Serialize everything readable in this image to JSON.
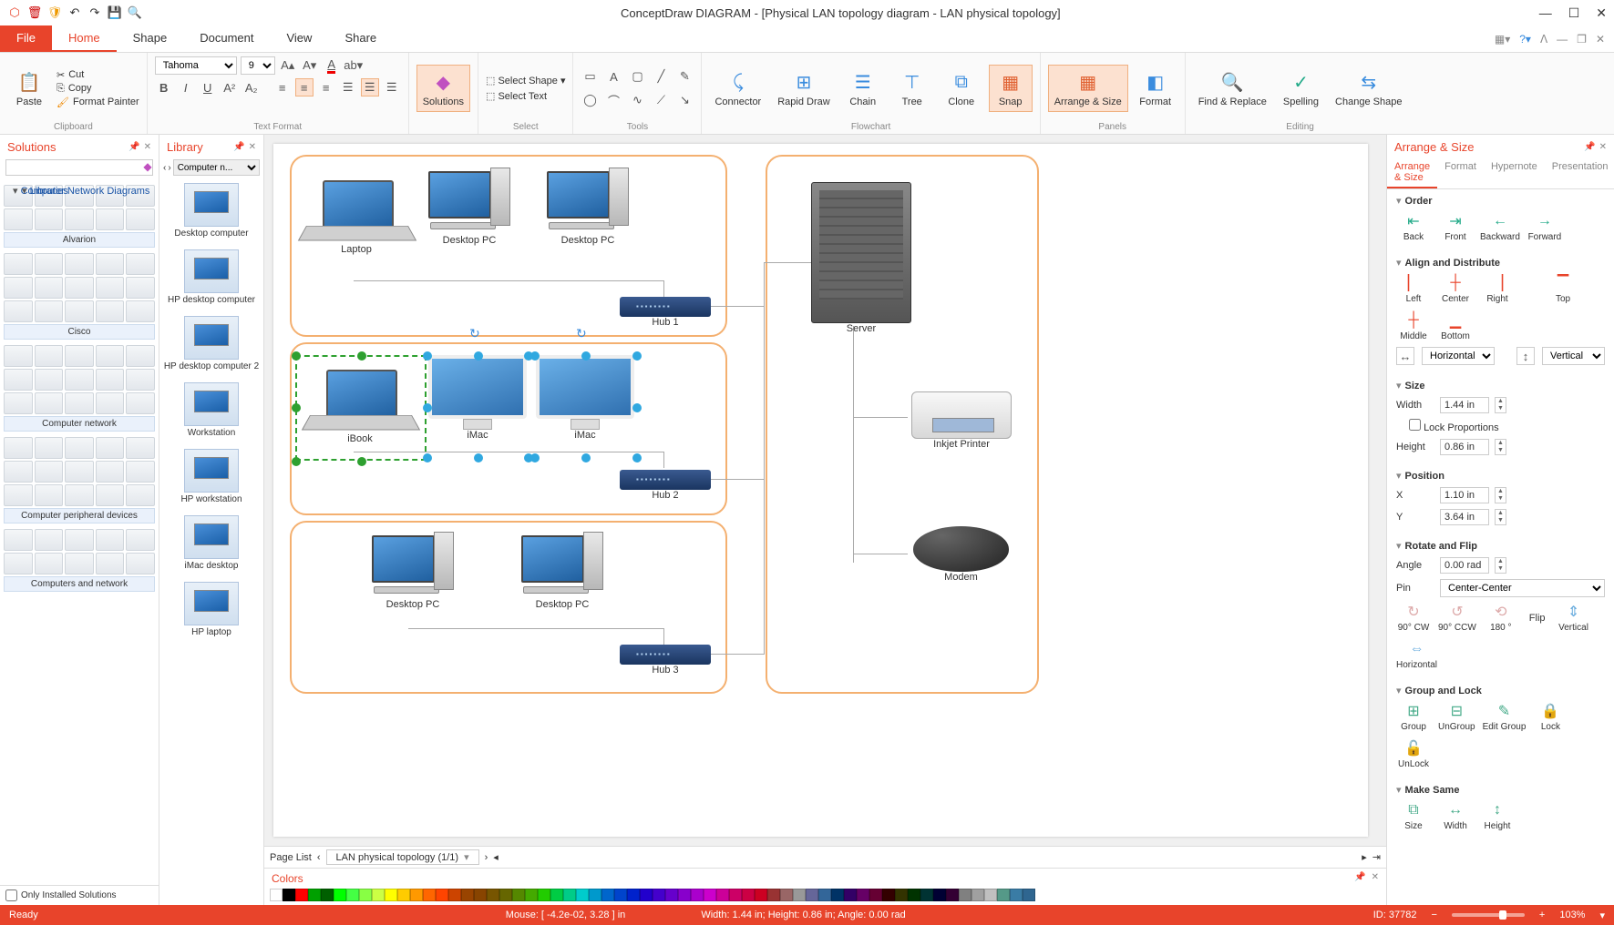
{
  "app": {
    "title": "ConceptDraw DIAGRAM - [Physical LAN topology diagram - LAN physical topology]"
  },
  "window_controls": {
    "min": "—",
    "max": "☐",
    "close": "✕"
  },
  "qat": {
    "logo": "⬡",
    "trash": "🗑",
    "shield": "🛡",
    "undo": "↶",
    "redo": "↷",
    "save": "💾",
    "preview": "🔍"
  },
  "tabs": {
    "file": "File",
    "home": "Home",
    "shape": "Shape",
    "document": "Document",
    "view": "View",
    "share": "Share"
  },
  "ribbon": {
    "clipboard": {
      "paste": "Paste",
      "cut": "Cut",
      "copy": "Copy",
      "format_painter": "Format Painter",
      "label": "Clipboard"
    },
    "textfmt": {
      "font": "Tahoma",
      "size": "9",
      "label": "Text Format"
    },
    "solutions": {
      "label": "Solutions"
    },
    "select": {
      "select_shape": "Select Shape",
      "select_text": "Select Text",
      "label": "Select"
    },
    "tools": {
      "label": "Tools"
    },
    "flowchart": {
      "connector": "Connector",
      "rapid": "Rapid Draw",
      "chain": "Chain",
      "tree": "Tree",
      "clone": "Clone",
      "snap": "Snap",
      "label": "Flowchart"
    },
    "panels": {
      "arrange": "Arrange & Size",
      "format": "Format",
      "label": "Panels"
    },
    "editing": {
      "find": "Find & Replace",
      "spelling": "Spelling",
      "change": "Change Shape",
      "label": "Editing"
    }
  },
  "solutions_panel": {
    "title": "Solutions",
    "tree_root": "Computer Network Diagrams",
    "tree_child": "Libraries",
    "groups": [
      "Alvarion",
      "Cisco",
      "Computer network",
      "Computer peripheral devices",
      "Computers and network"
    ],
    "only_installed": "Only Installed Solutions"
  },
  "library_panel": {
    "title": "Library",
    "dropdown": "Computer n...",
    "items": [
      "Desktop computer",
      "HP desktop computer",
      "HP desktop computer 2",
      "Workstation",
      "HP workstation",
      "iMac desktop",
      "HP laptop"
    ]
  },
  "canvas": {
    "nodes": {
      "laptop1": "Laptop",
      "desktop1": "Desktop PC",
      "desktop2": "Desktop PC",
      "hub1": "Hub 1",
      "ibook": "iBook",
      "imac1": "iMac",
      "imac2": "iMac",
      "hub2": "Hub 2",
      "desktop3": "Desktop PC",
      "desktop4": "Desktop PC",
      "hub3": "Hub 3",
      "server": "Server",
      "printer": "Inkjet Printer",
      "modem": "Modem"
    }
  },
  "pagelist": {
    "label": "Page List",
    "page": "LAN physical topology (1/1)"
  },
  "colors_panel": {
    "title": "Colors"
  },
  "arrange_panel": {
    "title": "Arrange & Size",
    "subtabs": {
      "arrange": "Arrange & Size",
      "format": "Format",
      "hypernote": "Hypernote",
      "presentation": "Presentation"
    },
    "order": {
      "title": "Order",
      "back": "Back",
      "front": "Front",
      "backward": "Backward",
      "forward": "Forward"
    },
    "align": {
      "title": "Align and Distribute",
      "left": "Left",
      "center": "Center",
      "right": "Right",
      "top": "Top",
      "middle": "Middle",
      "bottom": "Bottom",
      "horizontal": "Horizontal",
      "vertical": "Vertical"
    },
    "size": {
      "title": "Size",
      "width_l": "Width",
      "width_v": "1.44 in",
      "height_l": "Height",
      "height_v": "0.86 in",
      "lock": "Lock Proportions"
    },
    "position": {
      "title": "Position",
      "x_l": "X",
      "x_v": "1.10 in",
      "y_l": "Y",
      "y_v": "3.64 in"
    },
    "rotate": {
      "title": "Rotate and Flip",
      "angle_l": "Angle",
      "angle_v": "0.00 rad",
      "pin_l": "Pin",
      "pin_v": "Center-Center",
      "cw": "90° CW",
      "ccw": "90° CCW",
      "r180": "180 °",
      "flip_l": "Flip",
      "fv": "Vertical",
      "fh": "Horizontal"
    },
    "group": {
      "title": "Group and Lock",
      "group": "Group",
      "ungroup": "UnGroup",
      "edit": "Edit Group",
      "lock": "Lock",
      "unlock": "UnLock"
    },
    "same": {
      "title": "Make Same",
      "size": "Size",
      "width": "Width",
      "height": "Height"
    }
  },
  "status": {
    "ready": "Ready",
    "mouse": "Mouse: [ -4.2e-02, 3.28 ] in",
    "dims": "Width: 1.44 in;  Height: 0.86 in;  Angle: 0.00 rad",
    "id": "ID: 37782",
    "zoom": "103%"
  },
  "swatches": [
    "#ffffff",
    "#000000",
    "#ff0000",
    "#00a000",
    "#006000",
    "#00ff00",
    "#44ff44",
    "#88ff44",
    "#ccff44",
    "#ffff00",
    "#ffcc00",
    "#ff9900",
    "#ff6600",
    "#ff4400",
    "#cc4400",
    "#994400",
    "#884400",
    "#775500",
    "#666600",
    "#558800",
    "#44aa00",
    "#22cc00",
    "#00cc44",
    "#00cc88",
    "#00cccc",
    "#0099cc",
    "#0066cc",
    "#0044cc",
    "#0022cc",
    "#2200cc",
    "#4400cc",
    "#6600cc",
    "#8800cc",
    "#aa00cc",
    "#cc00cc",
    "#cc0099",
    "#cc0066",
    "#cc0044",
    "#cc0022",
    "#993333",
    "#996666",
    "#999999",
    "#666699",
    "#336699",
    "#003366",
    "#330066",
    "#660066",
    "#660033",
    "#330000",
    "#333300",
    "#003300",
    "#003333",
    "#000033",
    "#330033",
    "#808080",
    "#a0a0a0",
    "#c0c0c0",
    "#559988",
    "#3a7ca5",
    "#2f6690"
  ]
}
